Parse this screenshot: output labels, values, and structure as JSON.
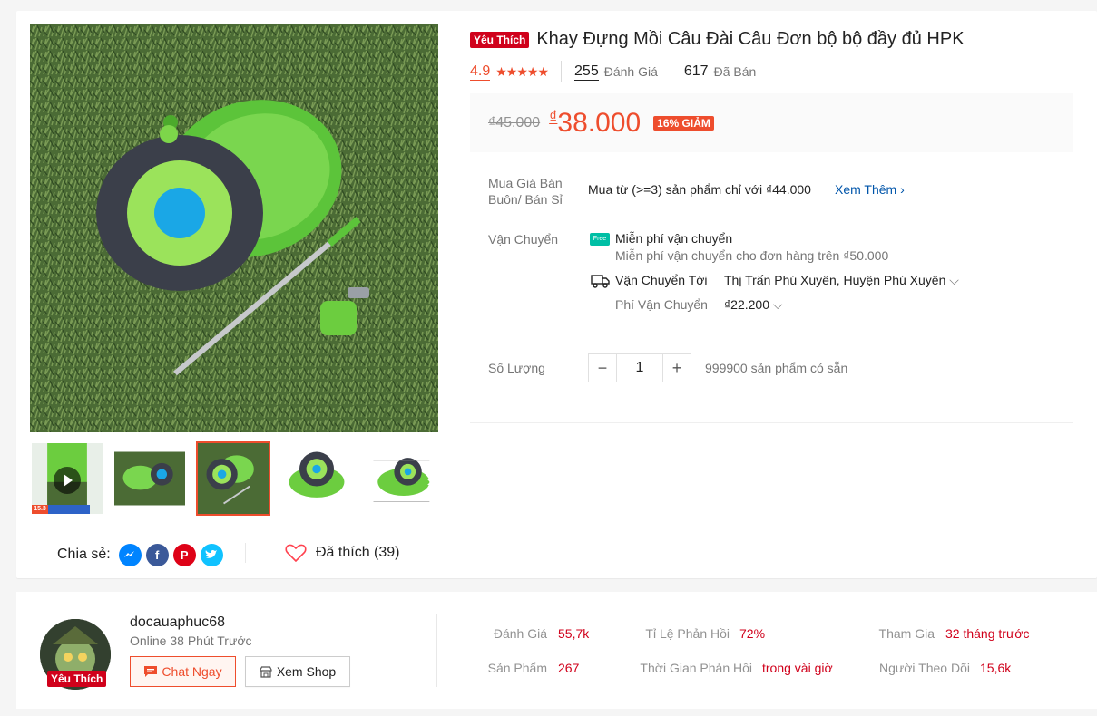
{
  "colors": {
    "accent": "#ee4d2d",
    "badge": "#d0011b",
    "link": "#0055aa"
  },
  "gallery": {
    "thumbs": [
      {
        "name": "video-thumb",
        "badge": "15.3"
      },
      {
        "name": "thumb-2"
      },
      {
        "name": "thumb-3"
      },
      {
        "name": "thumb-4"
      },
      {
        "name": "thumb-5"
      }
    ]
  },
  "share": {
    "label": "Chia sẻ:",
    "icons": [
      "messenger-icon",
      "facebook-icon",
      "pinterest-icon",
      "twitter-icon"
    ]
  },
  "like": {
    "label": "Đã thích (39)"
  },
  "product": {
    "badge": "Yêu Thích",
    "title": "Khay Đựng Mồi Câu Đài Câu Đơn bộ bộ đầy đủ HPK",
    "rating": "4.9",
    "stars": "★★★★★",
    "reviews_count": "255",
    "reviews_label": "Đánh Giá",
    "sold_count": "617",
    "sold_label": "Đã Bán",
    "old_price": "₫45.000",
    "currency": "₫",
    "price": "38.000",
    "discount": "16% GIẢM"
  },
  "wholesale": {
    "label": "Mua Giá Bán Buôn/ Bán Sỉ",
    "text": "Mua từ (>=3) sản phẩm chỉ với ₫44.000",
    "link": "Xem Thêm"
  },
  "shipping": {
    "label": "Vận Chuyển",
    "free_icon": "Free",
    "free_title": "Miễn phí vận chuyển",
    "free_sub": "Miễn phí vận chuyển cho đơn hàng trên ₫50.000",
    "to_label": "Vận Chuyển Tới",
    "to_value": "Thị Trấn Phú Xuyên, Huyện Phú Xuyên",
    "fee_label": "Phí Vận Chuyển",
    "fee_value": "₫22.200"
  },
  "quantity": {
    "label": "Số Lượng",
    "value": "1",
    "minus": "−",
    "plus": "+",
    "stock": "999900 sản phẩm có sẵn"
  },
  "shop": {
    "badge": "Yêu Thích",
    "name": "docauaphuc68",
    "online": "Online 38 Phút Trước",
    "chat_label": "Chat Ngay",
    "view_label": "Xem Shop",
    "stats": [
      {
        "label": "Đánh Giá",
        "value": "55,7k"
      },
      {
        "label": "Sản Phẩm",
        "value": "267"
      },
      {
        "label": "Tỉ Lệ Phản Hồi",
        "value": "72%"
      },
      {
        "label": "Thời Gian Phản Hồi",
        "value": "trong vài giờ"
      },
      {
        "label": "Tham Gia",
        "value": "32 tháng trước"
      },
      {
        "label": "Người Theo Dõi",
        "value": "15,6k"
      }
    ]
  }
}
